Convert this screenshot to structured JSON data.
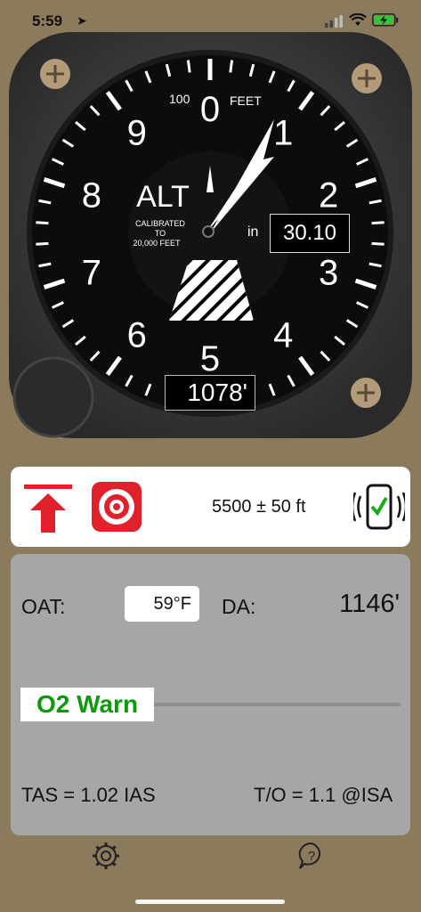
{
  "status_bar": {
    "time": "5:59",
    "location_icon": "location-arrow-icon"
  },
  "altimeter": {
    "dial_numbers": [
      "0",
      "1",
      "2",
      "3",
      "4",
      "5",
      "6",
      "7",
      "8",
      "9"
    ],
    "label_alt": "ALT",
    "label_feet": "FEET",
    "label_100": "100",
    "calibrated_line1": "CALIBRATED",
    "calibrated_line2": "TO",
    "calibrated_line3": "20,000 FEET",
    "altitude_readout": "1078'",
    "baro_label": "in",
    "baro_value": "30.10"
  },
  "target_card": {
    "target_altitude": "5500 ± 50 ft",
    "icons": [
      "takeoff-arrow-icon",
      "target-icon",
      "phone-vibrate-check-icon"
    ]
  },
  "info_panel": {
    "oat_label": "OAT:",
    "oat_value": "59°F",
    "da_label": "DA:",
    "da_value": "1146'",
    "o2_warn_label": "O2 Warn",
    "tas_text": "TAS = 1.02 IAS",
    "to_text": "T/O =  1.1 @ISA"
  },
  "colors": {
    "background": "#8c7a5c",
    "o2_green": "#0a9a0a",
    "accent_red": "#e0202a"
  }
}
